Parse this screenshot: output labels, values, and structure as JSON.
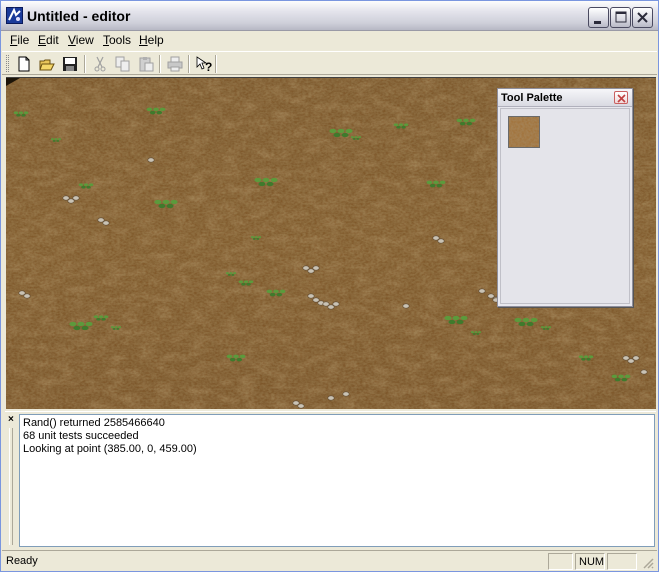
{
  "window": {
    "title": "Untitled - editor",
    "icons": {
      "app": "editor-app-icon",
      "minimize": "minimize-icon",
      "maximize": "maximize-icon",
      "close": "close-icon"
    }
  },
  "menu": {
    "items": [
      {
        "label": "File",
        "accel": "F",
        "rest": "ile"
      },
      {
        "label": "Edit",
        "accel": "E",
        "rest": "dit"
      },
      {
        "label": "View",
        "accel": "V",
        "rest": "iew"
      },
      {
        "label": "Tools",
        "accel": "T",
        "rest": "ools"
      },
      {
        "label": "Help",
        "accel": "H",
        "rest": "elp"
      }
    ]
  },
  "toolbar": {
    "buttons": [
      {
        "name": "new",
        "icon": "new-document-icon",
        "enabled": true
      },
      {
        "name": "open",
        "icon": "open-folder-icon",
        "enabled": true
      },
      {
        "name": "save",
        "icon": "save-disk-icon",
        "enabled": true
      },
      {
        "name": "cut",
        "icon": "cut-scissors-icon",
        "enabled": false
      },
      {
        "name": "copy",
        "icon": "copy-icon",
        "enabled": false
      },
      {
        "name": "paste",
        "icon": "paste-icon",
        "enabled": false
      },
      {
        "name": "print",
        "icon": "print-icon",
        "enabled": false
      },
      {
        "name": "help",
        "icon": "context-help-icon",
        "enabled": true
      }
    ]
  },
  "viewport": {
    "content": "terrain-view",
    "ground_color": "#80592c"
  },
  "palette": {
    "title": "Tool Palette",
    "tiles": [
      {
        "name": "dirt-texture-tile"
      }
    ]
  },
  "log": {
    "lines": [
      "Rand() returned 2585466640",
      "68 unit tests succeeded",
      "Looking at point (385.00, 0, 459.00)"
    ]
  },
  "status": {
    "text": "Ready",
    "panes": [
      "",
      "NUM",
      ""
    ]
  },
  "colors": {
    "accent": "#7a96df",
    "chrome": "#ece9d8"
  }
}
